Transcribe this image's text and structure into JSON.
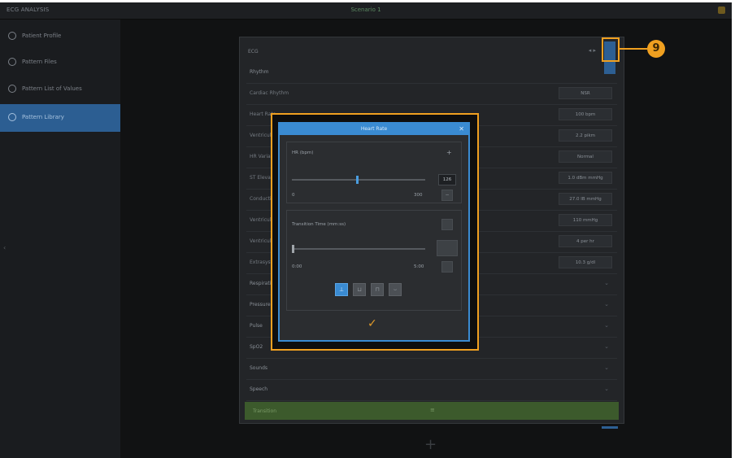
{
  "topbar": {
    "app_title": "ECG ANALYSIS",
    "center_title": "Scenario 1"
  },
  "sidebar": {
    "items": [
      {
        "label": "Patient Profile",
        "icon": "person-icon"
      },
      {
        "label": "Pattern Files",
        "icon": "file-icon"
      },
      {
        "label": "Pattern List of Values",
        "icon": "list-icon"
      },
      {
        "label": "Pattern Library",
        "icon": "library-icon"
      }
    ],
    "collapse_glyph": "‹"
  },
  "main": {
    "title": "ECG",
    "head_icons": "◂  ▸",
    "section_title": "Rhythm",
    "params": [
      {
        "label": "Cardiac Rhythm",
        "value": "NSR"
      },
      {
        "label": "Heart Rate",
        "value": "100 bpm"
      },
      {
        "label": "Ventricular",
        "value": "2.2 pikm"
      },
      {
        "label": "HR Variability",
        "value": "Normal"
      },
      {
        "label": "ST Elevation",
        "value": "1.0 dBm mmHg"
      },
      {
        "label": "Conduction",
        "value": "27.0 lB mmHg"
      },
      {
        "label": "Ventricular Lead",
        "value": "110 mmHg"
      },
      {
        "label": "Ventricular Rate",
        "value": "4 per hr"
      },
      {
        "label": "Extrasystoles",
        "value": "10.3 g/dl"
      }
    ],
    "groups": [
      {
        "label": "Respiration"
      },
      {
        "label": "Pressure"
      },
      {
        "label": "Pulse"
      },
      {
        "label": "SpO2"
      },
      {
        "label": "Sounds"
      },
      {
        "label": "Speech"
      }
    ],
    "green_bar_label": "Transition",
    "green_bar_mid": "≡"
  },
  "dialog": {
    "title": "Heart Rate",
    "close_glyph": "✕",
    "hr_label": "HR (bpm)",
    "hr_add": "+",
    "hr_value": "126",
    "hr_level": 0.48,
    "hr_min": "0",
    "hr_max": "300",
    "hr_remove": "−",
    "trans_label": "Transition Time (mm:ss)",
    "trans_value_box": "",
    "trans_level": 0.0,
    "trans_min": "0:00",
    "trans_max": "5:00",
    "modes": [
      "⊥",
      "⊔",
      "⊓",
      "⌣"
    ],
    "active_mode": 0,
    "confirm_glyph": "✓"
  },
  "callout": {
    "number": "9"
  },
  "bottom": {
    "plus_glyph": "+"
  }
}
